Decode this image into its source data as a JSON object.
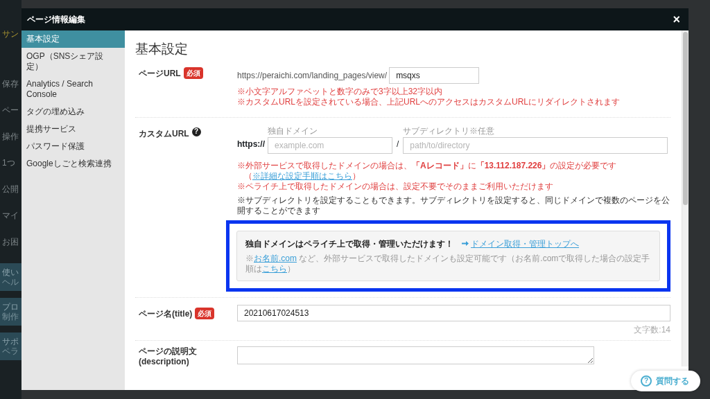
{
  "backdrop": {
    "fragments": [
      {
        "text": "サン",
        "kind": "gold"
      },
      {
        "text": "保存",
        "kind": "dim"
      },
      {
        "text": "ペー",
        "kind": "dim"
      },
      {
        "text": "操作",
        "kind": "dim"
      },
      {
        "text": "1つ",
        "kind": "dim"
      },
      {
        "text": "公開",
        "kind": "dim"
      },
      {
        "text": "マイ",
        "kind": "dim"
      },
      {
        "text": "お困",
        "kind": "dim"
      },
      {
        "text": "使い",
        "kind": "panel"
      },
      {
        "text": "ヘル",
        "kind": "sub"
      },
      {
        "text": "プロ",
        "kind": "panel"
      },
      {
        "text": "制作",
        "kind": "sub"
      },
      {
        "text": "サポ",
        "kind": "panel"
      },
      {
        "text": "ペラ",
        "kind": "sub"
      }
    ]
  },
  "modal": {
    "title": "ページ情報編集",
    "close": "×"
  },
  "sidebar": {
    "items": [
      {
        "label": "基本設定",
        "selected": true
      },
      {
        "label": "OGP（SNSシェア設定）",
        "selected": false
      },
      {
        "label": "Analytics / Search Console",
        "selected": false
      },
      {
        "label": "タグの埋め込み",
        "selected": false
      },
      {
        "label": "提携サービス",
        "selected": false
      },
      {
        "label": "パスワード保護",
        "selected": false
      },
      {
        "label": "Googleしごと検索連携",
        "selected": false
      }
    ]
  },
  "content": {
    "heading": "基本設定",
    "page_url": {
      "label": "ページURL",
      "badge": "必須",
      "prefix": "https://peraichi.com/landing_pages/view/",
      "value": "msqxs",
      "notes": [
        "※小文字アルファベットと数字のみで3字以上32字以内",
        "※カスタムURLを設定されている場合、上記URLへのアクセスはカスタムURLにリダイレクトされます"
      ]
    },
    "custom_url": {
      "label": "カスタムURL",
      "help": "?",
      "scheme": "https://",
      "separator": "/",
      "domain": {
        "label": "独自ドメイン",
        "placeholder": "example.com"
      },
      "subdir": {
        "label": "サブディレクトリ※任意",
        "placeholder": "path/to/directory"
      },
      "notes": [
        {
          "kind": "warning",
          "parts": [
            {
              "text": "※外部サービスで取得したドメインの場合は、**「Aレコード」**に**「13.112.187.226」**の設定が必要です"
            },
            {
              "text": "（"
            },
            {
              "link": "※詳細な設定手順はこちら"
            },
            {
              "text": "）"
            }
          ]
        },
        {
          "kind": "warning",
          "parts": [
            {
              "text": "※ペライチ上で取得したドメインの場合は、設定不要でそのままご利用いただけます"
            }
          ]
        },
        {
          "kind": "info",
          "parts": [
            {
              "text": "※サブディレクトリを設定することもできます。サブディレクトリを設定すると、同じドメインで複数のページを公開することができます"
            }
          ]
        }
      ],
      "promo": {
        "highlighted": true,
        "headline": "独自ドメインはペライチ上で取得・管理いただけます！",
        "link": "ドメイン取得・管理トップへ",
        "parts": [
          {
            "text": "※"
          },
          {
            "link": "お名前.com"
          },
          {
            "text": " など、外部サービスで取得したドメインも設定可能です（お名前.comで取得した場合の設定手順は"
          },
          {
            "link": "こちら"
          },
          {
            "text": "）"
          }
        ]
      }
    },
    "page_title": {
      "label": "ページ名(title)",
      "badge": "必須",
      "value": "20210617024513",
      "counter": "文字数:14"
    },
    "description": {
      "label_lines": [
        "ページの説明文",
        "(description)"
      ]
    }
  },
  "help_button": {
    "icon": "?",
    "label": "質問する"
  }
}
